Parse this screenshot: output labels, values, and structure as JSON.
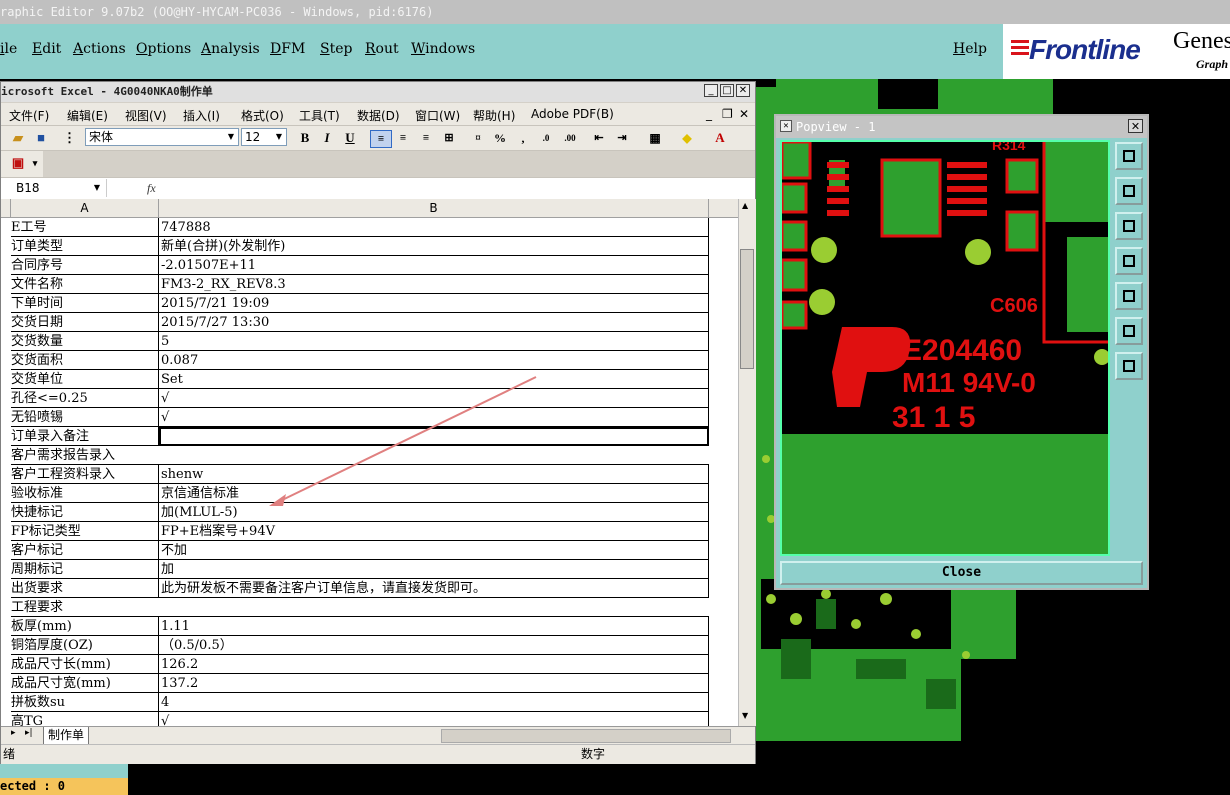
{
  "genesis": {
    "title": "raphic Editor 9.07b2 (OO@HY-HYCAM-PC036 - Windows, pid:6176)",
    "menus": [
      "ile",
      "Edit",
      "Actions",
      "Options",
      "Analysis",
      "DFM",
      "Step",
      "Rout",
      "Windows"
    ],
    "help": "Help",
    "brand": "Frontline",
    "brand_genesis": "Genes",
    "brand_graph": "Graph",
    "selected": "ected : 0"
  },
  "excel": {
    "title": "icrosoft Excel - 4G0040NKA0制作单",
    "menus": [
      "文件(F)",
      "编辑(E)",
      "视图(V)",
      "插入(I)",
      "格式(O)",
      "工具(T)",
      "数据(D)",
      "窗口(W)",
      "帮助(H)",
      "Adobe PDF(B)"
    ],
    "font_name": "宋体",
    "font_size": "12",
    "name_box": "B18",
    "fx": "fx",
    "col_a": "A",
    "col_b": "B",
    "sheet_tab": "制作单",
    "status_left": "绪",
    "status_mode": "数字",
    "rows": [
      {
        "a": "E工号",
        "b": "747888"
      },
      {
        "a": "订单类型",
        "b": "新单(合拼)(外发制作)"
      },
      {
        "a": "合同序号",
        "b": "-2.01507E+11"
      },
      {
        "a": "文件名称",
        "b": "FM3-2_RX_REV8.3"
      },
      {
        "a": "下单时间",
        "b": "2015/7/21 19:09"
      },
      {
        "a": "交货日期",
        "b": "2015/7/27 13:30"
      },
      {
        "a": "交货数量",
        "b": "5"
      },
      {
        "a": "交货面积",
        "b": "0.087"
      },
      {
        "a": "交货单位",
        "b": "Set"
      },
      {
        "a": "孔径<=0.25",
        "b": "√"
      },
      {
        "a": "无铅喷锡",
        "b": "√"
      },
      {
        "a": "订单录入备注",
        "b": ""
      },
      {
        "a": "客户需求报告录入",
        "b": "",
        "span": true
      },
      {
        "a": "客户工程资料录入",
        "b": "shenw"
      },
      {
        "a": "验收标准",
        "b": "京信通信标准"
      },
      {
        "a": "快捷标记",
        "b": "加(MLUL-5)"
      },
      {
        "a": "FP标记类型",
        "b": "FP+E档案号+94V"
      },
      {
        "a": "客户标记",
        "b": "不加"
      },
      {
        "a": "周期标记",
        "b": "加"
      },
      {
        "a": "出货要求",
        "b": "此为研发板不需要备注客户订单信息，请直接发货即可。"
      },
      {
        "a": "工程要求",
        "b": "",
        "span": true
      },
      {
        "a": "板厚(mm)",
        "b": "1.11"
      },
      {
        "a": "铜箔厚度(OZ)",
        "b": "（0.5/0.5）"
      },
      {
        "a": "成品尺寸长(mm)",
        "b": "126.2"
      },
      {
        "a": "成品尺寸宽(mm)",
        "b": "137.2"
      },
      {
        "a": "拼板数su",
        "b": "4"
      },
      {
        "a": "高TG",
        "b": "√"
      }
    ]
  },
  "popview": {
    "title": "Popview - 1",
    "close_label": "Close",
    "pcb_texts": [
      "E204460",
      "M11 94V-0",
      "C606",
      "R314",
      "31 1 5"
    ]
  },
  "colors": {
    "genesis_bg": "#8fd0cc",
    "pcb_green": "#2ea02e",
    "pcb_red": "#e01010",
    "annotation": "#e08080"
  }
}
